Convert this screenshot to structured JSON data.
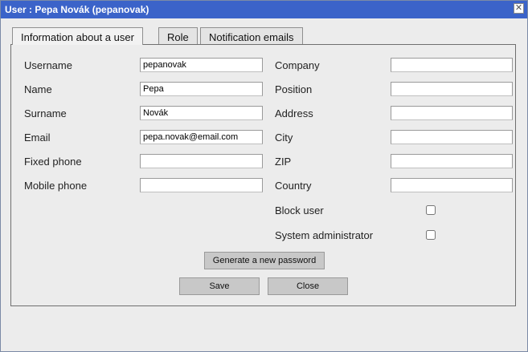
{
  "window": {
    "title": "User : Pepa Novák (pepanovak)",
    "close_icon": "close-icon"
  },
  "tabs": [
    {
      "label": "Information about a user",
      "active": true
    },
    {
      "label": "Role",
      "active": false
    },
    {
      "label": "Notification emails",
      "active": false
    }
  ],
  "form": {
    "left": [
      {
        "label": "Username",
        "value": "pepanovak"
      },
      {
        "label": "Name",
        "value": "Pepa"
      },
      {
        "label": "Surname",
        "value": "Novák"
      },
      {
        "label": "Email",
        "value": "pepa.novak@email.com"
      },
      {
        "label": "Fixed phone",
        "value": ""
      },
      {
        "label": "Mobile phone",
        "value": ""
      }
    ],
    "right": [
      {
        "label": "Company",
        "value": ""
      },
      {
        "label": "Position",
        "value": ""
      },
      {
        "label": "Address",
        "value": ""
      },
      {
        "label": "City",
        "value": ""
      },
      {
        "label": "ZIP",
        "value": ""
      },
      {
        "label": "Country",
        "value": ""
      }
    ],
    "checkboxes": [
      {
        "label": "Block user",
        "checked": false
      },
      {
        "label": "System administrator",
        "checked": false
      }
    ]
  },
  "buttons": {
    "generate_password": "Generate a new password",
    "save": "Save",
    "close": "Close"
  },
  "colors": {
    "titlebar": "#3b63c9",
    "title_text": "#ffffff",
    "background": "#ececec",
    "button": "#c8c8c8"
  }
}
